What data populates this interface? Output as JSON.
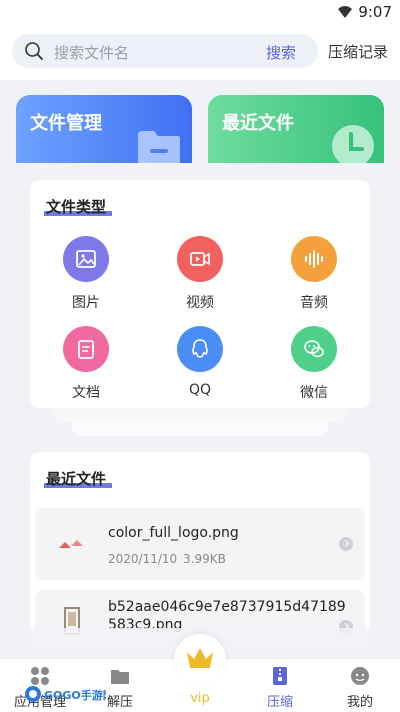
{
  "status": {
    "time": "9:07"
  },
  "search": {
    "placeholder": "搜索文件名",
    "button": "搜索"
  },
  "records_link": "压缩记录",
  "cards": {
    "files": "文件管理",
    "recent": "最近文件"
  },
  "file_types": {
    "title": "文件类型",
    "items": [
      {
        "label": "图片",
        "icon": "image-icon",
        "color": "#7e78e8"
      },
      {
        "label": "视频",
        "icon": "video-icon",
        "color": "#f0615f"
      },
      {
        "label": "音频",
        "icon": "audio-icon",
        "color": "#f4a03c"
      },
      {
        "label": "文档",
        "icon": "document-icon",
        "color": "#f06aa0"
      },
      {
        "label": "QQ",
        "icon": "qq-icon",
        "color": "#4c8cf5"
      },
      {
        "label": "微信",
        "icon": "wechat-icon",
        "color": "#4fd08a"
      }
    ]
  },
  "recent_files": {
    "title": "最近文件",
    "items": [
      {
        "name": "color_full_logo.png",
        "date": "2020/11/10",
        "size": "3.99KB"
      },
      {
        "name": "b52aae046c9e7e8737915d47189583c9.png"
      }
    ]
  },
  "nav": {
    "items": [
      {
        "label": "应用管理",
        "icon": "apps-icon"
      },
      {
        "label": "解压",
        "icon": "folder-icon"
      },
      {
        "label": "vip",
        "icon": "crown-icon",
        "color": "#f1b92c"
      },
      {
        "label": "压缩",
        "icon": "zip-icon",
        "color": "#5b63d8"
      },
      {
        "label": "我的",
        "icon": "profile-icon"
      }
    ]
  },
  "watermark": "GOGO手游网"
}
